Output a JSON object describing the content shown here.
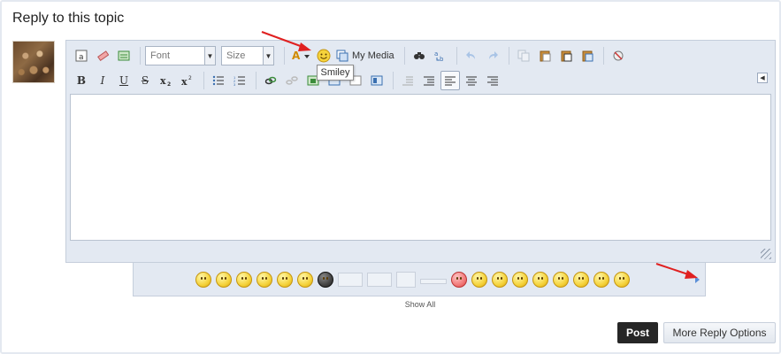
{
  "page": {
    "title": "Reply to this topic"
  },
  "toolbar": {
    "font_placeholder": "Font",
    "size_placeholder": "Size",
    "my_media_label": "My Media",
    "smiley_tooltip": "Smiley"
  },
  "toolbar_icons_row1": [
    "source-icon",
    "eraser-icon",
    "paste-text-icon",
    "font-color-icon",
    "smiley-icon",
    "my-media-icon",
    "find-icon",
    "replace-icon",
    "undo-icon",
    "redo-icon",
    "copy-icon",
    "paste-icon",
    "paste-word-icon",
    "paste-plain-icon",
    "spellcheck-icon"
  ],
  "toolbar_icons_row2": [
    "bold-icon",
    "italic-icon",
    "underline-icon",
    "strikethrough-icon",
    "subscript-icon",
    "superscript-icon",
    "bulleted-list-icon",
    "numbered-list-icon",
    "link-icon",
    "unlink-icon",
    "image-icon",
    "quote-icon",
    "code-icon",
    "spoiler-icon",
    "outdent-icon",
    "indent-icon",
    "align-left-icon",
    "align-center-icon",
    "align-right-icon"
  ],
  "smiley_panel": {
    "show_all_label": "Show All"
  },
  "actions": {
    "post_label": "Post",
    "more_options_label": "More Reply Options"
  },
  "colors": {
    "accent": "#262626",
    "editor_bg": "#e3e9f2",
    "annotation_arrow": "#e02020"
  }
}
